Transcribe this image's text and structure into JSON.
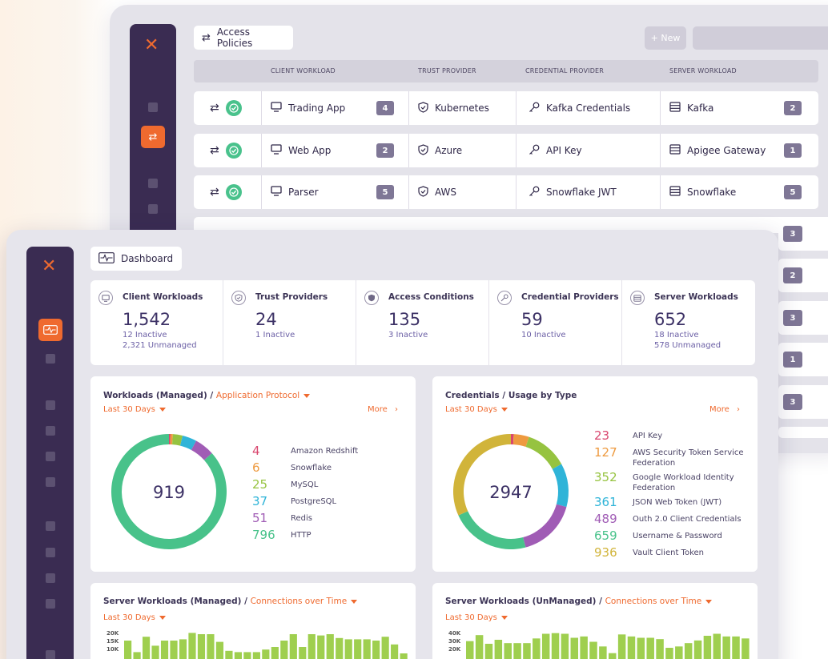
{
  "colors": {
    "accent": "#ef6a2f",
    "sidebar": "#3a2c52",
    "ok": "#49c28c",
    "badge": "#7f7796",
    "bar": "#9fcf4f"
  },
  "back": {
    "tab_label": "Access Policies",
    "new_label": "+ New",
    "columns": [
      "CLIENT WORKLOAD",
      "TRUST PROVIDER",
      "CREDENTIAL PROVIDER",
      "SERVER WORKLOAD"
    ],
    "rows": [
      {
        "client": "Trading App",
        "client_count": "4",
        "trust": "Kubernetes",
        "credential": "Kafka Credentials",
        "server": "Kafka",
        "server_count": "2"
      },
      {
        "client": "Web App",
        "client_count": "2",
        "trust": "Azure",
        "credential": "API Key",
        "server": "Apigee Gateway",
        "server_count": "1"
      },
      {
        "client": "Parser",
        "client_count": "5",
        "trust": "AWS",
        "credential": "Snowflake JWT",
        "server": "Snowflake",
        "server_count": "5"
      }
    ],
    "extra_badges": [
      "3",
      "2",
      "3",
      "1",
      "3"
    ]
  },
  "front": {
    "tab_label": "Dashboard",
    "stats": [
      {
        "title": "Client Workloads",
        "value": "1,542",
        "sub1": "12 Inactive",
        "sub2": "2,321 Unmanaged",
        "icon": "monitor-icon"
      },
      {
        "title": "Trust Providers",
        "value": "24",
        "sub1": "1 Inactive",
        "sub2": "",
        "icon": "shield-check-icon"
      },
      {
        "title": "Access Conditions",
        "value": "135",
        "sub1": "3 Inactive",
        "sub2": "",
        "icon": "shield-lock-icon"
      },
      {
        "title": "Credential Providers",
        "value": "59",
        "sub1": "10 Inactive",
        "sub2": "",
        "icon": "key-icon"
      },
      {
        "title": "Server Workloads",
        "value": "652",
        "sub1": "18 Inactive",
        "sub2": "578 Unmanaged",
        "icon": "server-icon"
      }
    ],
    "workloads_card": {
      "title": "Workloads (Managed) /",
      "selector": "Application Protocol",
      "range": "Last 30 Days",
      "more": "More",
      "total": "919",
      "legend": [
        {
          "value": "4",
          "label": "Amazon Redshift",
          "color": "#d9466e"
        },
        {
          "value": "6",
          "label": "Snowflake",
          "color": "#ee9a3f"
        },
        {
          "value": "25",
          "label": "MySQL",
          "color": "#96c340"
        },
        {
          "value": "37",
          "label": "PostgreSQL",
          "color": "#2fb4d8"
        },
        {
          "value": "51",
          "label": "Redis",
          "color": "#a05cb5"
        },
        {
          "value": "796",
          "label": "HTTP",
          "color": "#48c28a"
        }
      ]
    },
    "credentials_card": {
      "title": "Credentials / Usage by Type",
      "range": "Last 30 Days",
      "more": "More",
      "total": "2947",
      "legend": [
        {
          "value": "23",
          "label": "API Key",
          "label2": "",
          "color": "#d9466e"
        },
        {
          "value": "127",
          "label": "AWS Security Token Service",
          "label2": "Federation",
          "color": "#ee9a3f"
        },
        {
          "value": "352",
          "label": "Google Workload Identity",
          "label2": "Federation",
          "color": "#96c340"
        },
        {
          "value": "361",
          "label": "JSON Web Token (JWT)",
          "label2": "",
          "color": "#2fb4d8"
        },
        {
          "value": "489",
          "label": "Outh 2.0 Client Credentials",
          "label2": "",
          "color": "#a05cb5"
        },
        {
          "value": "659",
          "label": "Username & Password",
          "label2": "",
          "color": "#48c28a"
        },
        {
          "value": "936",
          "label": "Vault Client Token",
          "label2": "",
          "color": "#d1b43a"
        }
      ]
    },
    "server_managed_card": {
      "title": "Server Workloads (Managed) /",
      "selector": "Connections over Time",
      "range": "Last 30 Days",
      "ticks": [
        "20K",
        "15K",
        "10K"
      ]
    },
    "server_unmanaged_card": {
      "title": "Server Workloads (UnManaged) /",
      "selector": "Connections over Time",
      "range": "Last 30 Days",
      "ticks": [
        "40K",
        "30K",
        "20K"
      ]
    }
  },
  "chart_data": [
    {
      "type": "pie",
      "title": "Workloads (Managed) / Application Protocol",
      "center_label": "919",
      "categories": [
        "Amazon Redshift",
        "Snowflake",
        "MySQL",
        "PostgreSQL",
        "Redis",
        "HTTP"
      ],
      "values": [
        4,
        6,
        25,
        37,
        51,
        796
      ]
    },
    {
      "type": "pie",
      "title": "Credentials / Usage by Type",
      "center_label": "2947",
      "categories": [
        "API Key",
        "AWS Security Token Service Federation",
        "Google Workload Identity Federation",
        "JSON Web Token (JWT)",
        "Outh 2.0 Client Credentials",
        "Username & Password",
        "Vault Client Token"
      ],
      "values": [
        23,
        127,
        352,
        361,
        489,
        659,
        936
      ]
    },
    {
      "type": "bar",
      "title": "Server Workloads (Managed) / Connections over Time",
      "ylim": [
        0,
        25000
      ],
      "values": [
        15000,
        6000,
        18000,
        11000,
        15000,
        15000,
        16000,
        21000,
        20000,
        20000,
        14000,
        7000,
        6000,
        6000,
        6000,
        8000,
        10000,
        15000,
        20000,
        10000,
        20000,
        19000,
        20000,
        17000,
        16000,
        16000,
        16000,
        15000,
        18000,
        12000,
        5000
      ]
    },
    {
      "type": "bar",
      "title": "Server Workloads (UnManaged) / Connections over Time",
      "ylim": [
        0,
        48000
      ],
      "values": [
        28000,
        37000,
        24000,
        30000,
        25000,
        25000,
        25000,
        32000,
        39000,
        40000,
        39000,
        33000,
        35000,
        27000,
        20000,
        10000,
        38000,
        35000,
        33000,
        33000,
        31000,
        18000,
        20000,
        25000,
        29000,
        36000,
        39000,
        35000,
        35000,
        32000
      ]
    }
  ]
}
